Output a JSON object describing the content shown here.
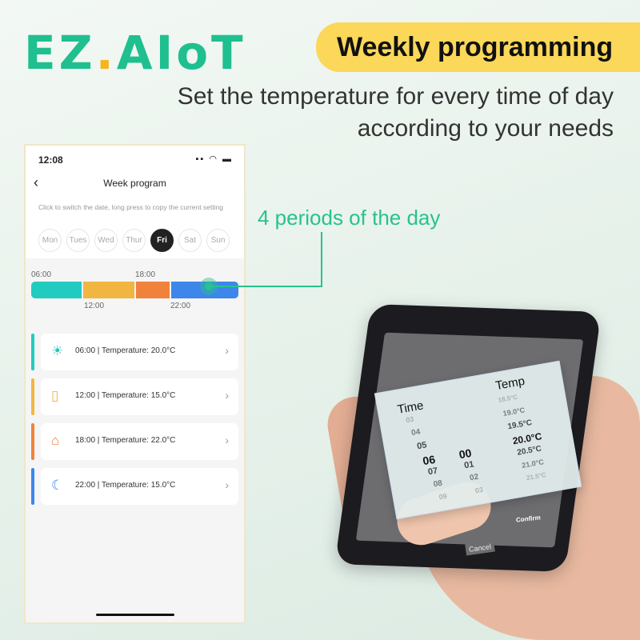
{
  "brand": {
    "logo_text": "EZAIoT",
    "colors": {
      "green": "#1fbf8f",
      "yellow": "#f5b51c"
    }
  },
  "banner": {
    "title": "Weekly programming",
    "color": "#fbd75a"
  },
  "subtitle": {
    "line1": "Set the temperature for every time of day",
    "line2": "according to your needs"
  },
  "callout": {
    "text": "4 periods of the day",
    "color": "#27c28f"
  },
  "app": {
    "status": {
      "time": "12:08",
      "icons": [
        "location-icon",
        "signal-icon",
        "wifi-icon",
        "battery-icon"
      ]
    },
    "header": {
      "title": "Week program",
      "back_icon": "chevron-left-icon"
    },
    "hint": "Click to switch the date, long press to copy the current setting",
    "days": [
      "Mon",
      "Tues",
      "Wed",
      "Thur",
      "Fri",
      "Sat",
      "Sun"
    ],
    "selected_day": "Fri",
    "timeline": {
      "top_labels": [
        "06:00",
        "18:00"
      ],
      "bottom_labels": [
        "12:00",
        "22:00"
      ],
      "segments": [
        {
          "start": "06:00",
          "color": "#22cbbf"
        },
        {
          "start": "12:00",
          "color": "#f1b641"
        },
        {
          "start": "18:00",
          "color": "#f0823c"
        },
        {
          "start": "22:00",
          "color": "#3d86ea"
        }
      ]
    },
    "periods": [
      {
        "icon": "sun-icon",
        "text": "06:00  |  Temperature: 20.0°C",
        "color": "#22cbbf"
      },
      {
        "icon": "door-icon",
        "text": "12:00  |  Temperature: 15.0°C",
        "color": "#f1b641"
      },
      {
        "icon": "home-icon",
        "text": "18:00  |  Temperature: 22.0°C",
        "color": "#f0823c"
      },
      {
        "icon": "moon-icon",
        "text": "22:00  |  Temperature: 15.0°C",
        "color": "#3d86ea"
      }
    ]
  },
  "picker": {
    "time_label": "Time",
    "temp_label": "Temp",
    "hours": [
      "03",
      "04",
      "05",
      "06",
      "07",
      "08",
      "09"
    ],
    "minutes": [
      "00",
      "01",
      "02",
      "03"
    ],
    "temps": [
      "18.5°C",
      "19.0°C",
      "19.5°C",
      "20.0°C",
      "20.5°C",
      "21.0°C",
      "21.5°C"
    ],
    "cancel": "Cancel",
    "confirm": "Confirm"
  }
}
